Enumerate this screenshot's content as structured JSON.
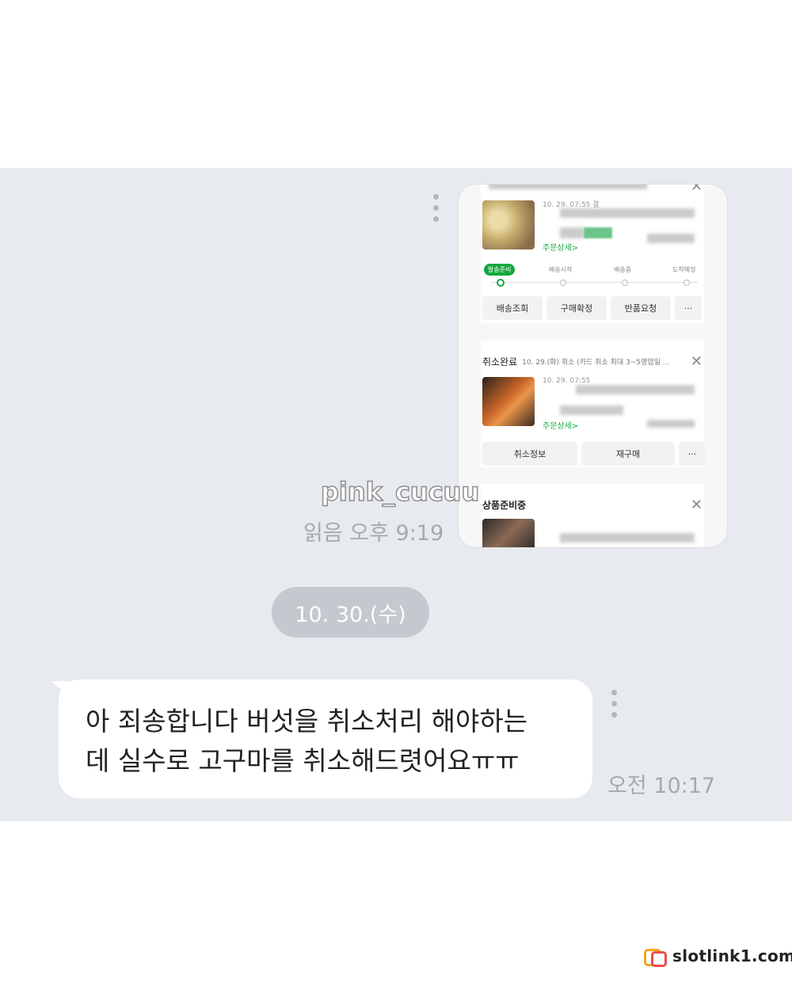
{
  "shared_image": {
    "card_a": {
      "order_date": "10. 29. 07:55 결",
      "detail_link": "주문상세>",
      "steps": [
        "발송준비",
        "배송시작",
        "배송중",
        "도착예정"
      ],
      "buttons": [
        "배송조회",
        "구매확정",
        "반품요청",
        "···"
      ]
    },
    "card_b": {
      "status": "취소완료",
      "note": "10. 29.(화) 취소 (카드 취소 최대 3~5영업일 ...",
      "order_date": "10. 29. 07:55",
      "detail_link": "주문상세>",
      "buttons": [
        "취소정보",
        "재구매",
        "···"
      ]
    },
    "card_c": {
      "status": "상품준비중"
    },
    "close_glyph": "✕"
  },
  "watermark_user": "pink_cucuu",
  "sent_status": "읽음 오후 9:19",
  "date_separator": "10. 30.(수)",
  "received_message": {
    "text": "아 죄송합니다 버섯을 취소처리 해야하는\n데 실수로 고구마를 취소해드렷어요ㅠㅠ",
    "time": "오전 10:17"
  },
  "site_watermark": "slotlink1.com"
}
